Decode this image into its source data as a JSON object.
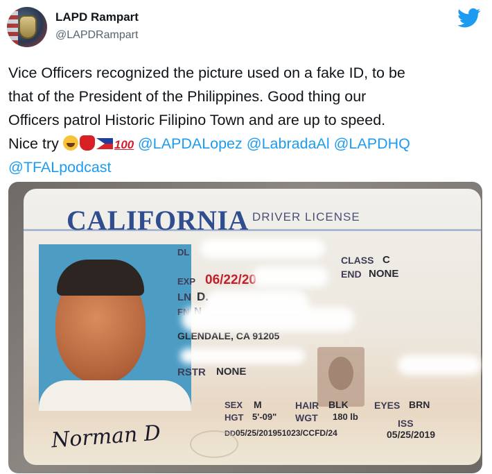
{
  "tweet": {
    "display_name": "LAPD Rampart",
    "handle": "@LAPDRampart",
    "text_lines": [
      "Vice Officers recognized the picture used on a fake ID, to be",
      "that of the President of the Philippines. Good thing our",
      "Officers patrol Historic Filipino Town and are up to speed."
    ],
    "text_line4_prefix": "Nice try",
    "mentions": [
      "@LAPDALopez",
      "@LabradaAl",
      "@LAPDHQ",
      "@TFALpodcast"
    ],
    "emoji": [
      "face-with-tears-of-joy",
      "boxing-glove",
      "philippines-flag",
      "hundred-points"
    ],
    "emoji_100_text": "100",
    "colors": {
      "link": "#1d9bf0",
      "twitter_blue": "#1d9bf0",
      "text": "#0f1419",
      "muted": "#536471"
    }
  },
  "license": {
    "state": "CALIFORNIA",
    "type": "DRIVER LICENSE",
    "dl_label": "DL",
    "exp_label": "EXP",
    "exp_value": "06/22/20",
    "ln_label": "LN",
    "ln_value": "D.",
    "fn_label": "FN",
    "fn_value": "N",
    "address": "GLENDALE, CA 91205",
    "class_label": "CLASS",
    "class_value": "C",
    "end_label": "END",
    "end_value": "NONE",
    "rstr_label": "RSTR",
    "rstr_value": "NONE",
    "sex_label": "SEX",
    "sex_value": "M",
    "hgt_label": "HGT",
    "hgt_value": "5'-09\"",
    "hair_label": "HAIR",
    "hair_value": "BLK",
    "wgt_label": "WGT",
    "wgt_value": "180 lb",
    "eyes_label": "EYES",
    "eyes_value": "BRN",
    "iss_label": "ISS",
    "iss_value": "05/25/2019",
    "dd_label": "DD",
    "dd_value": "05/25/201951023/CCFD/24",
    "signature": "Norman D"
  }
}
